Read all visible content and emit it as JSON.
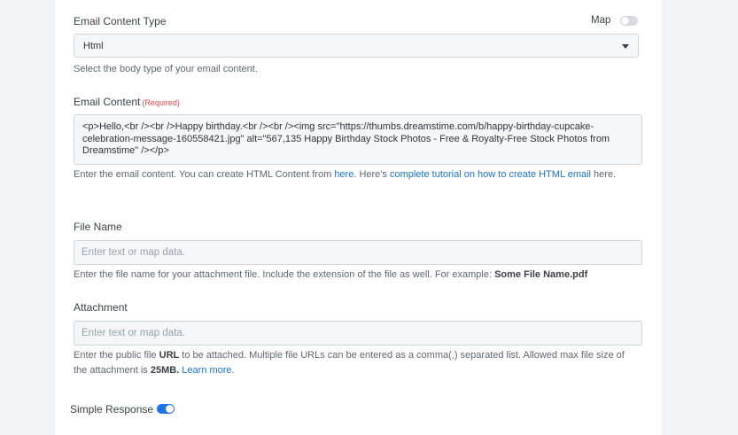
{
  "email_content_type": {
    "label": "Email Content Type",
    "map_label": "Map",
    "selected": "Html",
    "help": "Select the body type of your email content."
  },
  "email_content": {
    "label": "Email Content",
    "required": "(Required)",
    "value": "<p>Hello,<br /><br />Happy birthday.<br /><br /><img src=\"https://thumbs.dreamstime.com/b/happy-birthday-cupcake-celebration-message-160558421.jpg\" alt=\"567,135 Happy Birthday Stock Photos - Free & Royalty-Free Stock Photos from Dreamstime\" /></p>",
    "help_prefix": "Enter the email content. You can create HTML Content from ",
    "help_link1": "here",
    "help_mid": ". Here's ",
    "help_link2": "complete tutorial on how to create HTML email",
    "help_suffix": " here."
  },
  "file_name": {
    "label": "File Name",
    "placeholder": "Enter text or map data.",
    "help_prefix": "Enter the file name for your attachment file. Include the extension of the file as well. For example: ",
    "help_example": "Some File Name.pdf"
  },
  "attachment": {
    "label": "Attachment",
    "placeholder": "Enter text or map data.",
    "help_p1": "Enter the public file ",
    "help_url": "URL",
    "help_p2": " to be attached. Multiple file URLs can be entered as a comma(,) separated list. Allowed max file size of the attachment is ",
    "help_size": "25MB.",
    "help_space": " ",
    "help_link": "Learn more."
  },
  "simple_response": {
    "label": "Simple Response",
    "enabled": true
  },
  "colors": {
    "accent": "#1a73e8",
    "link": "#1a73c8",
    "required": "#e0464b"
  }
}
